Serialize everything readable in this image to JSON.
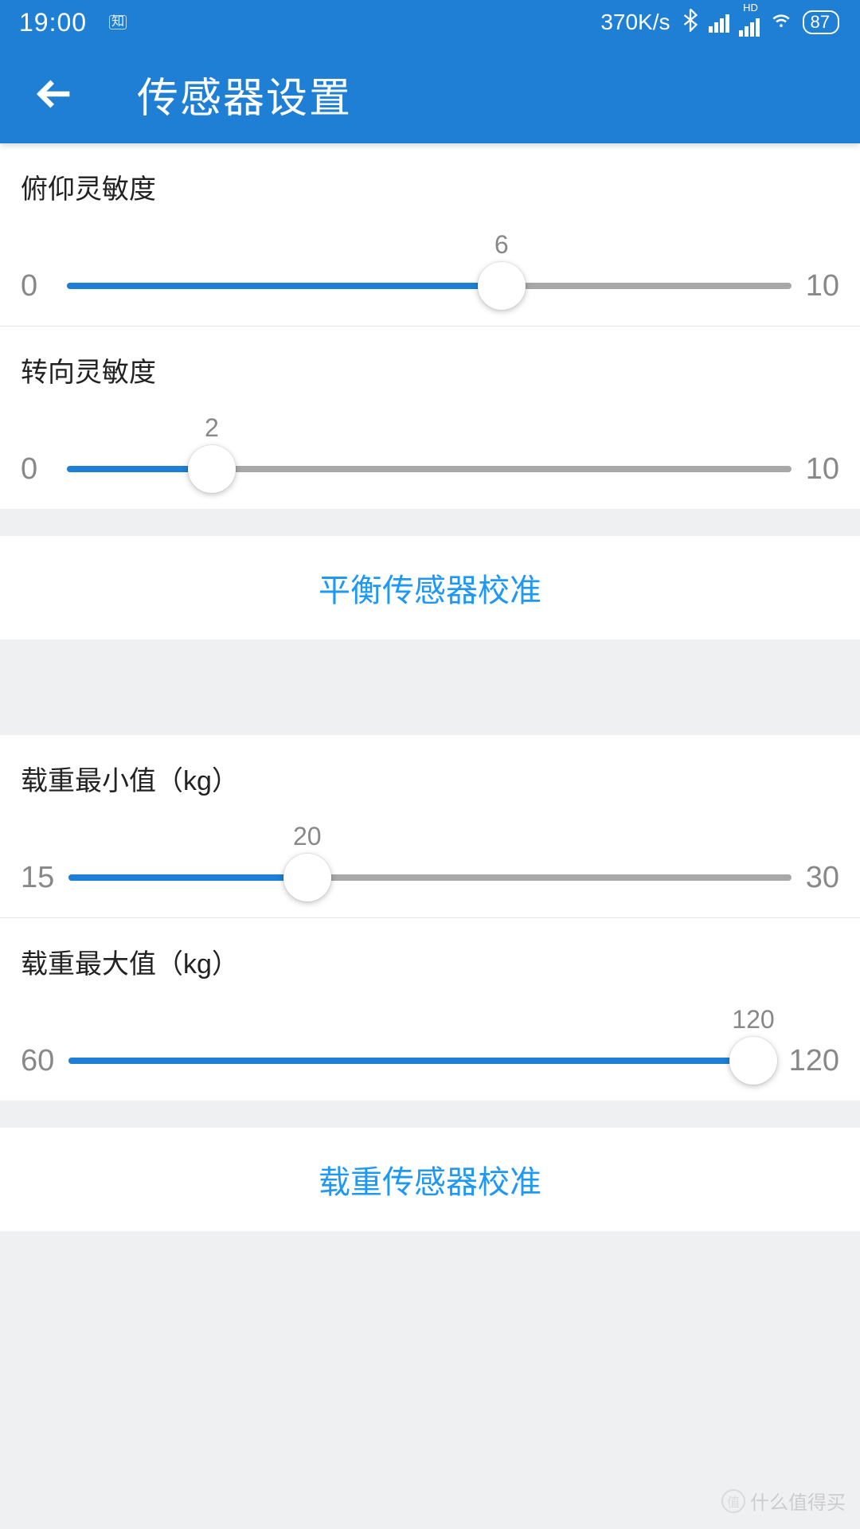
{
  "status_bar": {
    "time": "19:00",
    "notif_badge": "知",
    "speed": "370K/s",
    "hd_label": "HD",
    "battery": "87"
  },
  "app_bar": {
    "title": "传感器设置"
  },
  "sliders": {
    "pitch": {
      "label": "俯仰灵敏度",
      "min": "0",
      "max": "10",
      "value": "6",
      "percent": 60
    },
    "turn": {
      "label": "转向灵敏度",
      "min": "0",
      "max": "10",
      "value": "2",
      "percent": 20
    },
    "load_min": {
      "label": "载重最小值（kg）",
      "min": "15",
      "max": "30",
      "value": "20",
      "percent": 33
    },
    "load_max": {
      "label": "载重最大值（kg）",
      "min": "60",
      "max": "120",
      "value": "120",
      "percent": 100
    }
  },
  "buttons": {
    "balance_calib": "平衡传感器校准",
    "load_calib": "载重传感器校准"
  },
  "watermark": {
    "badge": "值",
    "text": "什么值得买"
  }
}
